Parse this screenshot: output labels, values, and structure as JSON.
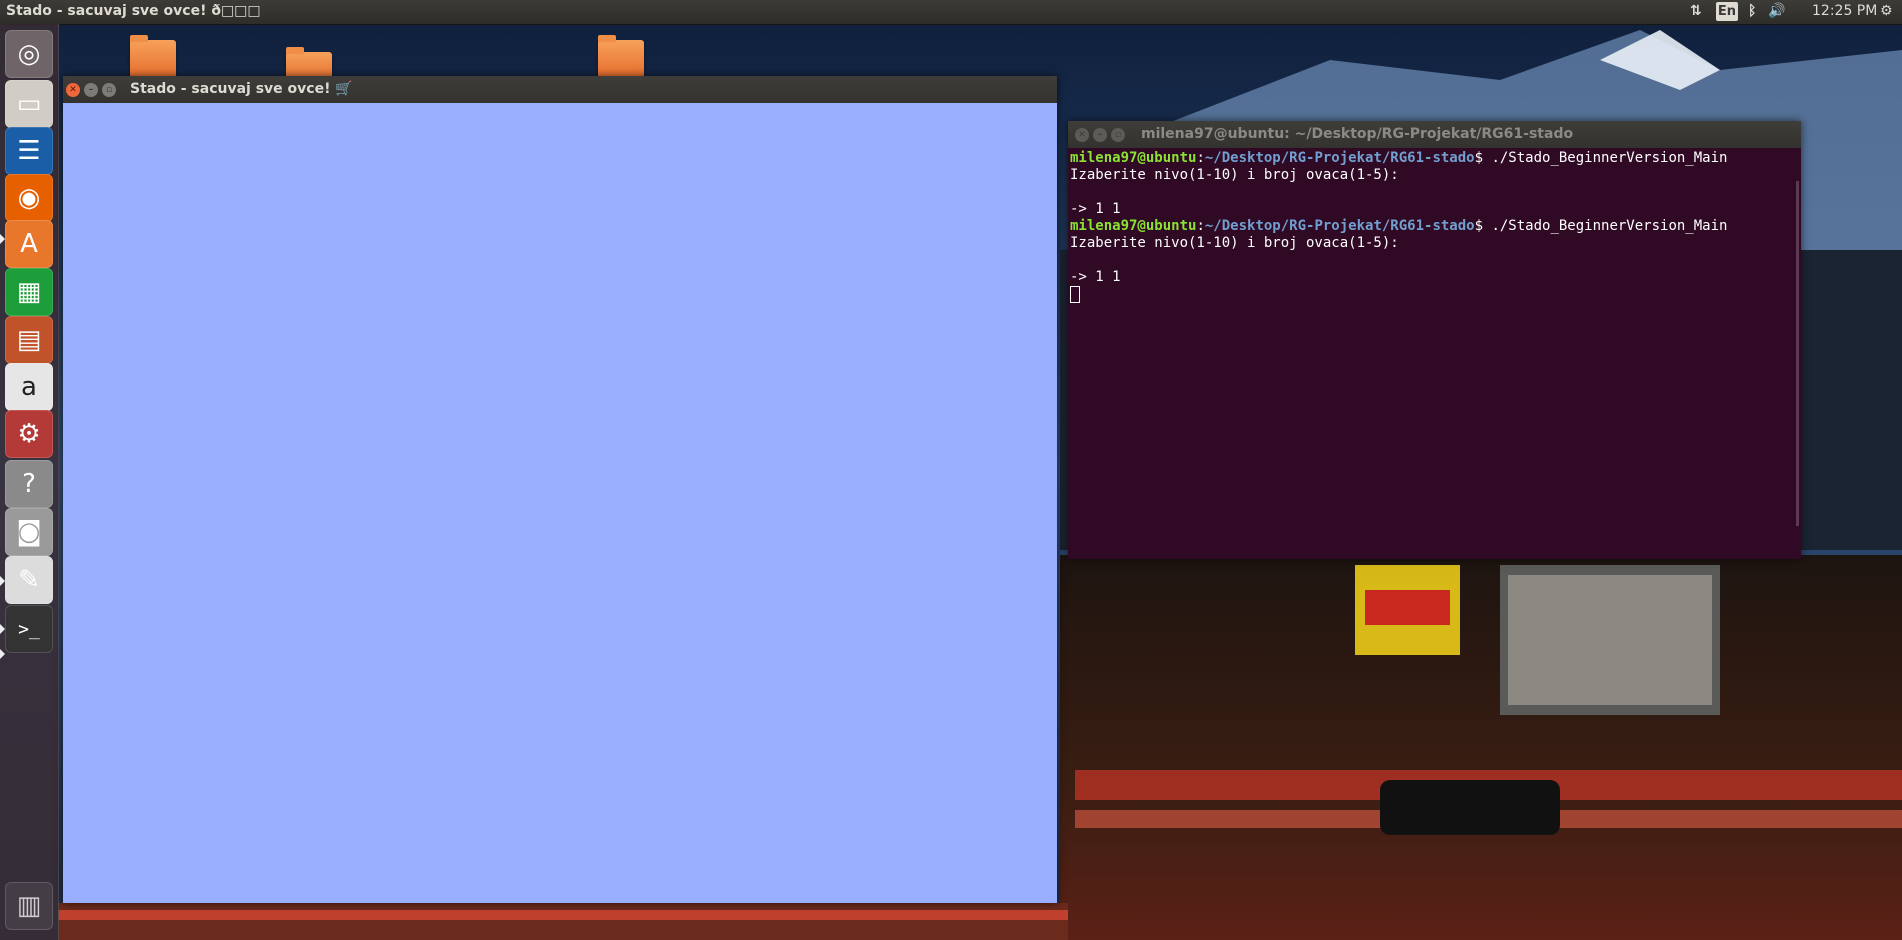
{
  "top_panel": {
    "window_title": "Stado - sacuvaj sve ovce! ð□□□",
    "keyboard_layout": "En",
    "clock": "12:25 PM",
    "indicators": [
      "network-arrows-icon",
      "bluetooth-icon",
      "volume-icon",
      "gear-icon"
    ]
  },
  "launcher": {
    "items": [
      {
        "name": "ubuntu-dash-icon",
        "glyph": "◎",
        "color": "#6f6467"
      },
      {
        "name": "files-icon",
        "glyph": "▭",
        "color": "#d1cdc6"
      },
      {
        "name": "writer-icon",
        "glyph": "☰",
        "color": "#1b5ea8"
      },
      {
        "name": "firefox-icon",
        "glyph": "◉",
        "color": "#e66000"
      },
      {
        "name": "software-center-icon",
        "glyph": "A",
        "color": "#e8762b"
      },
      {
        "name": "calc-icon",
        "glyph": "▦",
        "color": "#1e9e3a"
      },
      {
        "name": "impress-icon",
        "glyph": "▤",
        "color": "#c0532a"
      },
      {
        "name": "amazon-icon",
        "glyph": "a",
        "color": "#e6e6e6"
      },
      {
        "name": "system-settings-icon",
        "glyph": "⚙",
        "color": "#b43a38"
      },
      {
        "name": "help-icon",
        "glyph": "?",
        "color": "#8a8a8a"
      },
      {
        "name": "camera-icon",
        "glyph": "◙",
        "color": "#9a9a9a"
      },
      {
        "name": "text-editor-icon",
        "glyph": "✎",
        "color": "#dcdcdc"
      },
      {
        "name": "terminal-icon",
        "glyph": ">_",
        "color": "#333333"
      }
    ],
    "trash": {
      "name": "trash-icon",
      "glyph": "▥",
      "color": "#cfcfcf"
    }
  },
  "stado_window": {
    "title": "Stado - sacuvaj sve ovce! 🛒",
    "canvas_color": "#99aeff"
  },
  "terminal_window": {
    "title": "milena97@ubuntu: ~/Desktop/RG-Projekat/RG61-stado",
    "lines": [
      {
        "type": "prompt",
        "user": "milena97@ubuntu",
        "path": "~/Desktop/RG-Projekat/RG61-stado",
        "cmd": "$ ./Stado_BeginnerVersion_Main"
      },
      {
        "type": "text",
        "text": "Izaberite nivo(1-10) i broj ovaca(1-5):"
      },
      {
        "type": "text",
        "text": ""
      },
      {
        "type": "text",
        "text": "-> 1 1"
      },
      {
        "type": "prompt",
        "user": "milena97@ubuntu",
        "path": "~/Desktop/RG-Projekat/RG61-stado",
        "cmd": "$ ./Stado_BeginnerVersion_Main"
      },
      {
        "type": "text",
        "text": "Izaberite nivo(1-10) i broj ovaca(1-5):"
      },
      {
        "type": "text",
        "text": ""
      },
      {
        "type": "text",
        "text": "-> 1 1"
      }
    ]
  }
}
